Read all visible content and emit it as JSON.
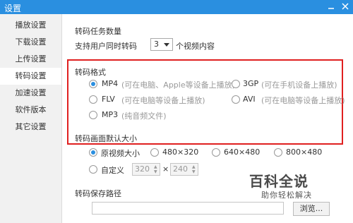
{
  "window": {
    "title": "设置"
  },
  "sidebar": {
    "items": [
      {
        "label": "播放设置"
      },
      {
        "label": "下载设置"
      },
      {
        "label": "上传设置"
      },
      {
        "label": "转码设置"
      },
      {
        "label": "加速设置"
      },
      {
        "label": "软件版本"
      },
      {
        "label": "其它设置"
      }
    ],
    "active_index": 3
  },
  "tasks": {
    "heading": "转码任务数量",
    "prefix": "支持用户同时转码",
    "value": "3",
    "suffix": "个视频内容"
  },
  "format": {
    "heading": "转码格式",
    "options": [
      {
        "name": "MP4",
        "desc": "(可在电脑、Apple等设备上播放)",
        "selected": true
      },
      {
        "name": "3GP",
        "desc": "(可在手机设备上播放)",
        "selected": false
      },
      {
        "name": "FLV",
        "desc": "(可在电脑等设备上播放)",
        "selected": false
      },
      {
        "name": "AVI",
        "desc": "(可在电脑等设备上播放)",
        "selected": false
      },
      {
        "name": "MP3",
        "desc": "(纯音频文件)",
        "selected": false
      }
    ]
  },
  "size": {
    "heading": "转码画面默认大小",
    "options": [
      {
        "label": "原视频大小",
        "selected": true
      },
      {
        "label": "480×320",
        "selected": false
      },
      {
        "label": "640×480",
        "selected": false
      },
      {
        "label": "800×480",
        "selected": false
      },
      {
        "label": "自定义",
        "selected": false
      }
    ],
    "custom_width": "320",
    "custom_height": "240",
    "times": "×"
  },
  "path": {
    "heading": "转码保存路径",
    "value": "",
    "browse_label": "浏览..."
  },
  "watermark": {
    "line1": "百科全说",
    "line2": "助你轻松解决"
  },
  "colors": {
    "titlebar": "#2a8fe0",
    "highlight_border": "#e02020"
  }
}
